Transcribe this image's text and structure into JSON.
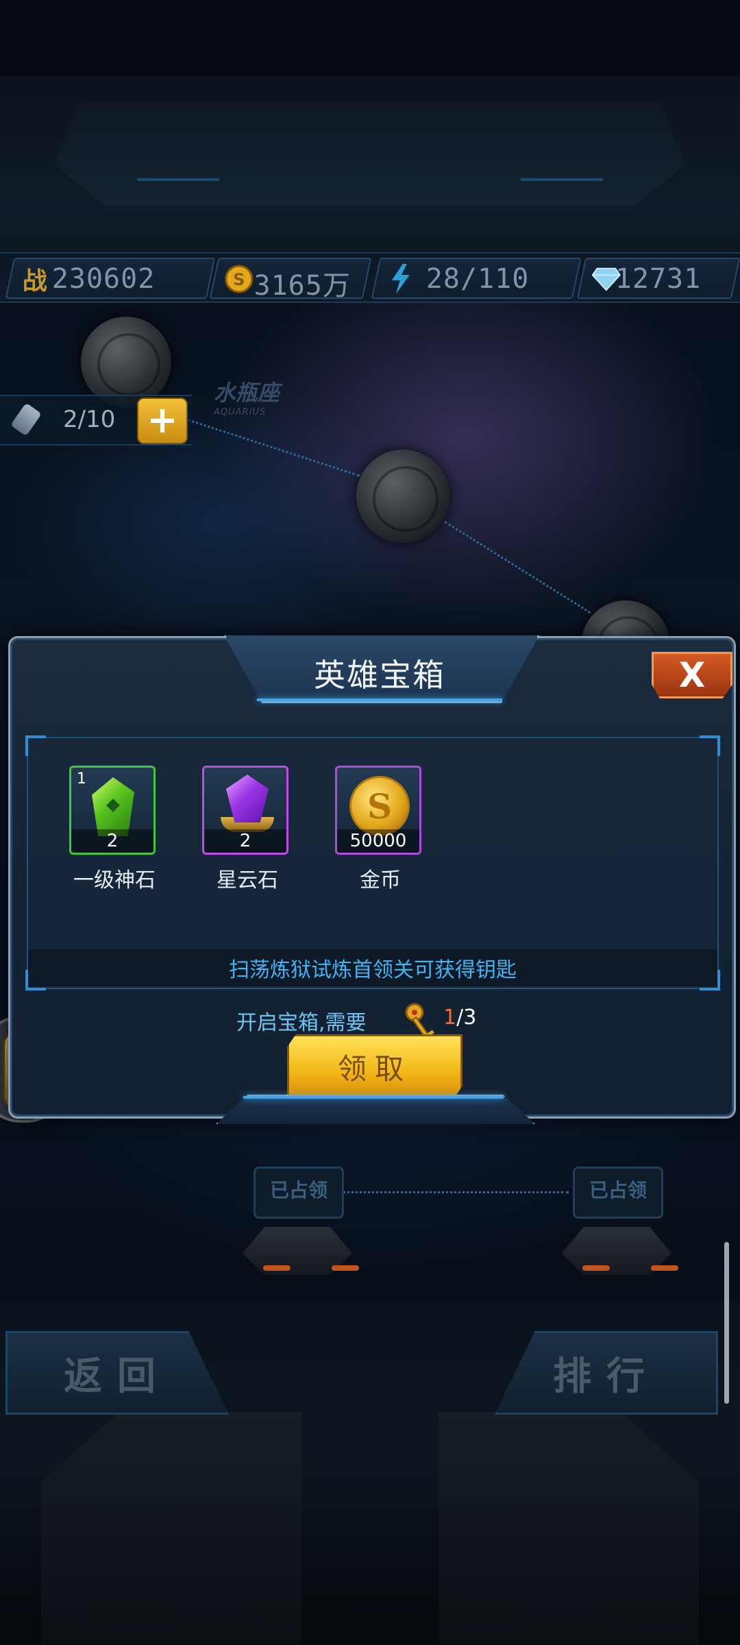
{
  "resources": {
    "power": {
      "icon": "power-badge-icon",
      "label": "战",
      "value": "230602"
    },
    "gold": {
      "icon": "gold-coin-icon",
      "value": "3165万"
    },
    "energy": {
      "icon": "lightning-icon",
      "value": "28/110"
    },
    "diamond": {
      "icon": "diamond-icon",
      "value": "12731"
    }
  },
  "map": {
    "zodiac_cn": "水瓶座",
    "zodiac_en": "AQUARIUS",
    "stamina": "2/10",
    "stamina_plus": "+",
    "occupied_label": "已占领"
  },
  "footer": {
    "back_label": "返回",
    "rank_label": "排行"
  },
  "modal": {
    "title": "英雄宝箱",
    "close_label": "X",
    "rewards": [
      {
        "name": "一级神石",
        "qty": "2",
        "tier": "1",
        "icon": "green-gem-icon",
        "border": "#3ec93a"
      },
      {
        "name": "星云石",
        "qty": "2",
        "icon": "purple-gem-icon",
        "border": "#c04be8"
      },
      {
        "name": "金币",
        "qty": "50000",
        "icon": "gold-coin-icon",
        "border": "#b14be0"
      }
    ],
    "hint": "扫荡炼狱试炼首领关可获得钥匙",
    "need_text": "开启宝箱,需要",
    "key_have": "1",
    "key_total": "/3",
    "claim_label": "领取"
  },
  "colors": {
    "accent_blue": "#40b3f2",
    "claim_gold": "#f3b61a",
    "close_orange": "#d55a22"
  }
}
